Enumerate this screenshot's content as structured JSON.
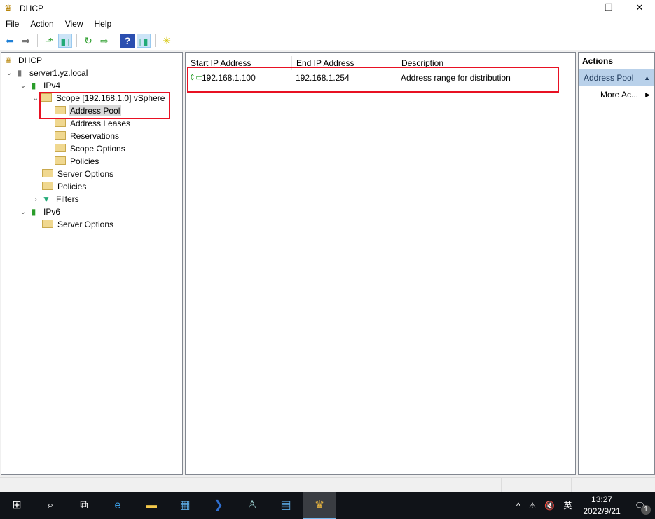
{
  "window": {
    "title": "DHCP",
    "minimize": "—",
    "maximize": "❐",
    "close": "✕"
  },
  "menu": [
    "File",
    "Action",
    "View",
    "Help"
  ],
  "tree": {
    "root": "DHCP",
    "server": "server1.yz.local",
    "ipv4": "IPv4",
    "scope": "Scope [192.168.1.0] vSphere",
    "scope_children": [
      "Address Pool",
      "Address Leases",
      "Reservations",
      "Scope Options",
      "Policies"
    ],
    "ipv4_children": [
      "Server Options",
      "Policies",
      "Filters"
    ],
    "ipv6": "IPv6",
    "ipv6_children": [
      "Server Options"
    ]
  },
  "list": {
    "columns": [
      "Start IP Address",
      "End IP Address",
      "Description"
    ],
    "rows": [
      {
        "start": "192.168.1.100",
        "end": "192.168.1.254",
        "description": "Address range for distribution"
      }
    ]
  },
  "actions": {
    "header": "Actions",
    "section": "Address Pool",
    "more": "More Ac..."
  },
  "taskbar": {
    "time": "13:27",
    "date": "2022/9/21",
    "ime": "英",
    "notifications": "1"
  },
  "colors": {
    "highlight": "#e81123",
    "accent": "#b9d1ea"
  }
}
